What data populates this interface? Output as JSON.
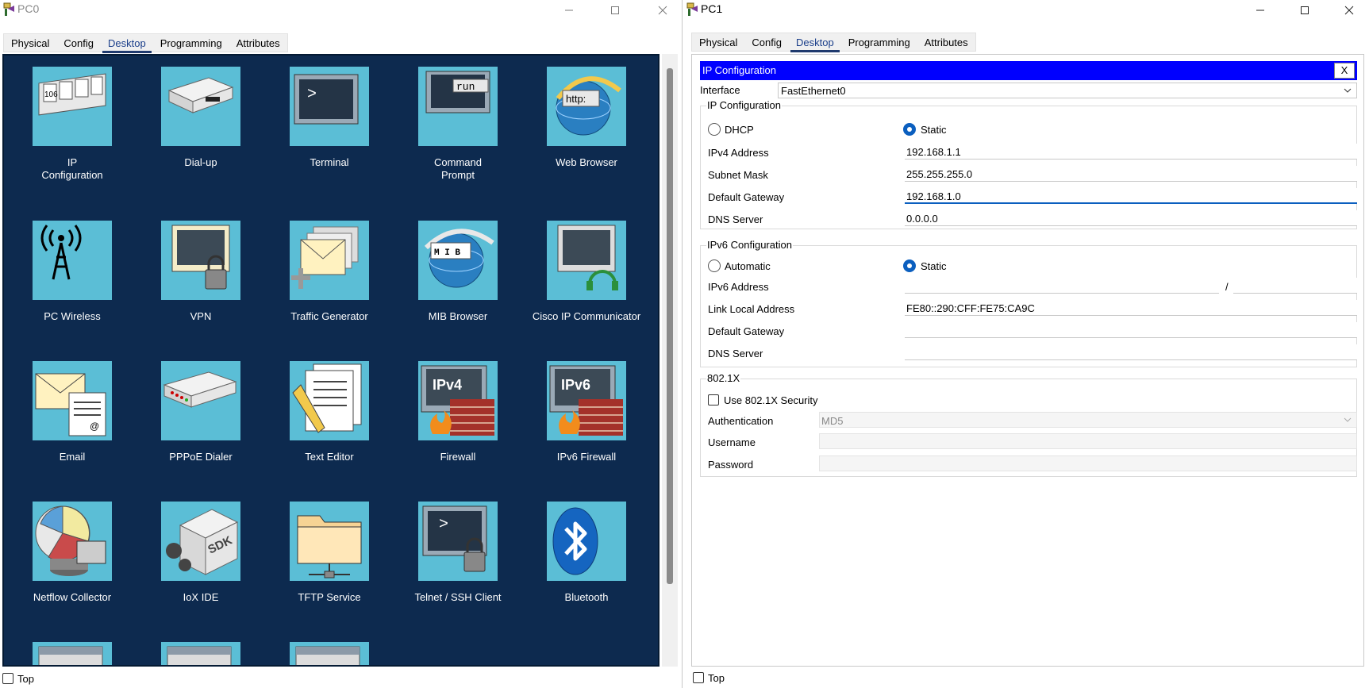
{
  "pc0": {
    "title": "PC0",
    "tabs": [
      "Physical",
      "Config",
      "Desktop",
      "Programming",
      "Attributes"
    ],
    "active_tab": "Desktop",
    "apps": [
      {
        "label": "IP\nConfiguration",
        "icon": "ip-config-icon",
        "icon_text": "106"
      },
      {
        "label": "Dial-up",
        "icon": "modem-icon"
      },
      {
        "label": "Terminal",
        "icon": "terminal-icon",
        "icon_text": ">"
      },
      {
        "label": "Command\nPrompt",
        "icon": "command-prompt-icon",
        "icon_text": "run"
      },
      {
        "label": "Web Browser",
        "icon": "web-browser-icon",
        "icon_text": "http:"
      },
      {
        "label": "PC Wireless",
        "icon": "wireless-tower-icon"
      },
      {
        "label": "VPN",
        "icon": "vpn-monitor-lock-icon"
      },
      {
        "label": "Traffic Generator",
        "icon": "traffic-generator-icon"
      },
      {
        "label": "MIB Browser",
        "icon": "mib-browser-icon",
        "icon_text": "M I B"
      },
      {
        "label": "Cisco IP Communicator",
        "icon": "ip-communicator-headset-icon"
      },
      {
        "label": "Email",
        "icon": "email-icon"
      },
      {
        "label": "PPPoE Dialer",
        "icon": "pppoe-dialer-icon"
      },
      {
        "label": "Text Editor",
        "icon": "text-editor-icon"
      },
      {
        "label": "Firewall",
        "icon": "firewall-icon",
        "icon_text": "IPv4"
      },
      {
        "label": "IPv6 Firewall",
        "icon": "ipv6-firewall-icon",
        "icon_text": "IPv6"
      },
      {
        "label": "Netflow Collector",
        "icon": "netflow-collector-icon"
      },
      {
        "label": "IoX IDE",
        "icon": "iox-sdk-icon",
        "icon_text": "SDK"
      },
      {
        "label": "TFTP Service",
        "icon": "tftp-folder-icon"
      },
      {
        "label": "Telnet / SSH Client",
        "icon": "telnet-ssh-icon",
        "icon_text": ">"
      },
      {
        "label": "Bluetooth",
        "icon": "bluetooth-icon"
      },
      {
        "label": "",
        "icon": "window-app-icon"
      },
      {
        "label": "",
        "icon": "window-app-icon"
      },
      {
        "label": "",
        "icon": "window-app-icon"
      }
    ],
    "top_label": "Top"
  },
  "pc1": {
    "title": "PC1",
    "tabs": [
      "Physical",
      "Config",
      "Desktop",
      "Programming",
      "Attributes"
    ],
    "active_tab": "Desktop",
    "ipconfig": {
      "header": "IP Configuration",
      "close": "X",
      "interface_label": "Interface",
      "interface_value": "FastEthernet0",
      "ipv4": {
        "group_label": "IP Configuration",
        "dhcp_label": "DHCP",
        "static_label": "Static",
        "mode": "Static",
        "ipv4_label": "IPv4 Address",
        "ipv4_value": "192.168.1.1",
        "mask_label": "Subnet Mask",
        "mask_value": "255.255.255.0",
        "gateway_label": "Default Gateway",
        "gateway_value": "192.168.1.0",
        "dns_label": "DNS Server",
        "dns_value": "0.0.0.0"
      },
      "ipv6": {
        "group_label": "IPv6 Configuration",
        "auto_label": "Automatic",
        "static_label": "Static",
        "mode": "Static",
        "addr_label": "IPv6 Address",
        "addr_value": "",
        "prefix_sep": "/",
        "prefix_value": "",
        "link_local_label": "Link Local Address",
        "link_local_value": "FE80::290:CFF:FE75:CA9C",
        "gateway_label": "Default Gateway",
        "gateway_value": "",
        "dns_label": "DNS Server",
        "dns_value": ""
      },
      "dot1x": {
        "group_label": "802.1X",
        "use_label": "Use 802.1X Security",
        "use_checked": false,
        "auth_label": "Authentication",
        "auth_value": "MD5",
        "username_label": "Username",
        "username_value": "",
        "password_label": "Password",
        "password_value": ""
      }
    },
    "top_label": "Top"
  },
  "colors": {
    "desktop_bg": "#0d2a4f",
    "icon_tile": "#5bbed6",
    "ip_header_bar": "#0000ff",
    "accent": "#0b5fbf"
  }
}
